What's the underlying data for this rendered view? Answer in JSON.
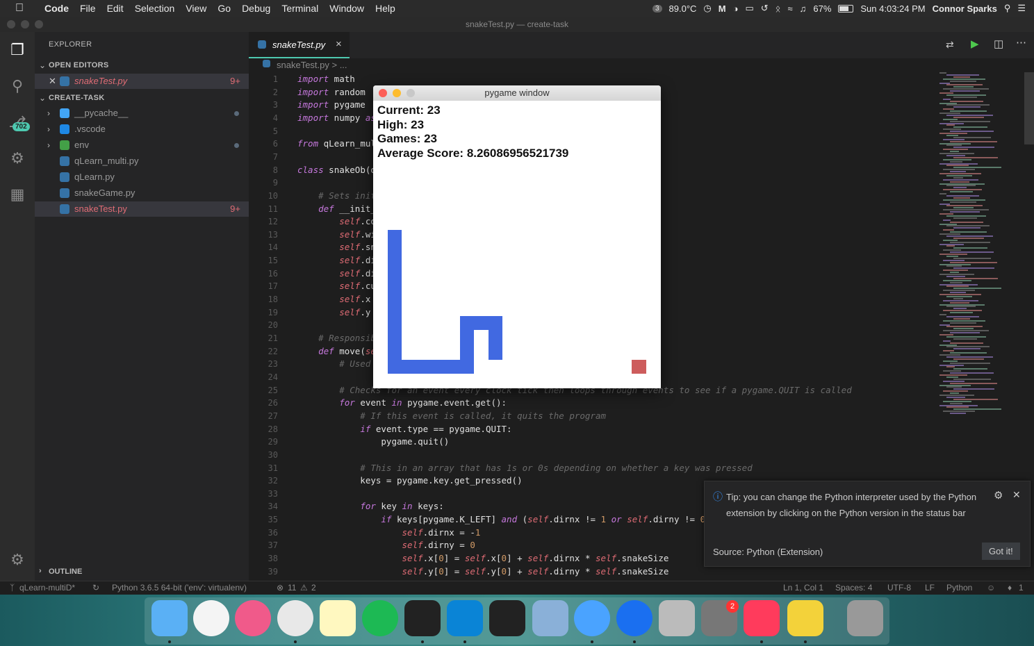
{
  "menubar": {
    "items": [
      "Code",
      "File",
      "Edit",
      "Selection",
      "View",
      "Go",
      "Debug",
      "Terminal",
      "Window",
      "Help"
    ],
    "status": {
      "temp": "89.0°C",
      "battery": "67%",
      "datetime": "Sun 4:03:24 PM",
      "user": "Connor Sparks",
      "notif_count": "3"
    }
  },
  "window_title": "snakeTest.py — create-task",
  "activity": {
    "scm_badge": "702"
  },
  "sidebar": {
    "title": "EXPLORER",
    "open_editors_header": "OPEN EDITORS",
    "open_editors": [
      {
        "name": "snakeTest.py",
        "count": "9+"
      }
    ],
    "folder_header": "CREATE-TASK",
    "items": [
      {
        "name": "__pycache__",
        "type": "folder"
      },
      {
        "name": ".vscode",
        "type": "folder"
      },
      {
        "name": "env",
        "type": "folder"
      },
      {
        "name": "qLearn_multi.py",
        "type": "file"
      },
      {
        "name": "qLearn.py",
        "type": "file"
      },
      {
        "name": "snakeGame.py",
        "type": "file"
      },
      {
        "name": "snakeTest.py",
        "type": "file",
        "count": "9+"
      }
    ],
    "outline": "OUTLINE"
  },
  "tab": {
    "label": "snakeTest.py",
    "close": "×"
  },
  "breadcrumb": "snakeTest.py > ...",
  "code": {
    "start_line": 1,
    "lines": [
      "import math",
      "import random",
      "import pygame",
      "import numpy as np",
      "",
      "from qLearn_multi import *",
      "",
      "class snakeOb(object):",
      "",
      "    # Sets initial variables",
      "    def __init__(self):",
      "        self.color",
      "        self.width",
      "        self.snakeSize",
      "        self.dirnx",
      "        self.dirny",
      "        self.currentScore",
      "        self.x",
      "        self.y",
      "",
      "    # Responsible for movement",
      "    def move(self):",
      "        # Used",
      "",
      "        # Checks for an event every clock tick then loops through events to see if a pygame.QUIT is called",
      "        for event in pygame.event.get():",
      "            # If this event is called, it quits the program",
      "            if event.type == pygame.QUIT:",
      "                pygame.quit()",
      "",
      "            # This in an array that has 1s or 0s depending on whether a key was pressed",
      "            keys = pygame.key.get_pressed()",
      "",
      "            for key in keys:",
      "                if keys[pygame.K_LEFT] and (self.dirnx != 1 or self.dirny != 0):",
      "                    self.dirnx = -1",
      "                    self.dirny = 0",
      "                    self.x[0] = self.x[0] + self.dirnx * self.snakeSize",
      "                    self.y[0] = self.y[0] + self.dirny * self.snakeSize"
    ]
  },
  "pygame": {
    "title": "pygame window",
    "lines": [
      "Current: 23",
      "High: 23",
      "Games: 23",
      "Average Score: 8.26086956521739"
    ],
    "snake_color": "#4169e1",
    "food_color": "#cd5c5c"
  },
  "toast": {
    "message": "Tip: you can change the Python interpreter used by the Python extension by clicking on the Python version in the status bar",
    "source": "Source: Python (Extension)",
    "button": "Got it!"
  },
  "status": {
    "branch": "qLearn-multiD*",
    "interpreter": "Python 3.6.5 64-bit ('env': virtualenv)",
    "errors": "11",
    "warnings": "2",
    "position": "Ln 1, Col 1",
    "spaces": "Spaces: 4",
    "encoding": "UTF-8",
    "eol": "LF",
    "language": "Python",
    "bell": "1"
  },
  "dock": {
    "apps": [
      "finder-icon",
      "photos-icon",
      "itunes-icon",
      "chrome-icon",
      "notes-icon",
      "spotify-icon",
      "terminal-icon",
      "vscode-icon",
      "stocks-icon",
      "mail-icon",
      "messages-icon",
      "teamviewer-icon",
      "disk-utility-icon",
      "system-preferences-icon",
      "screen-app-icon",
      "cyberduck-icon",
      "trash-icon"
    ],
    "sysprefs_badge": "2"
  }
}
